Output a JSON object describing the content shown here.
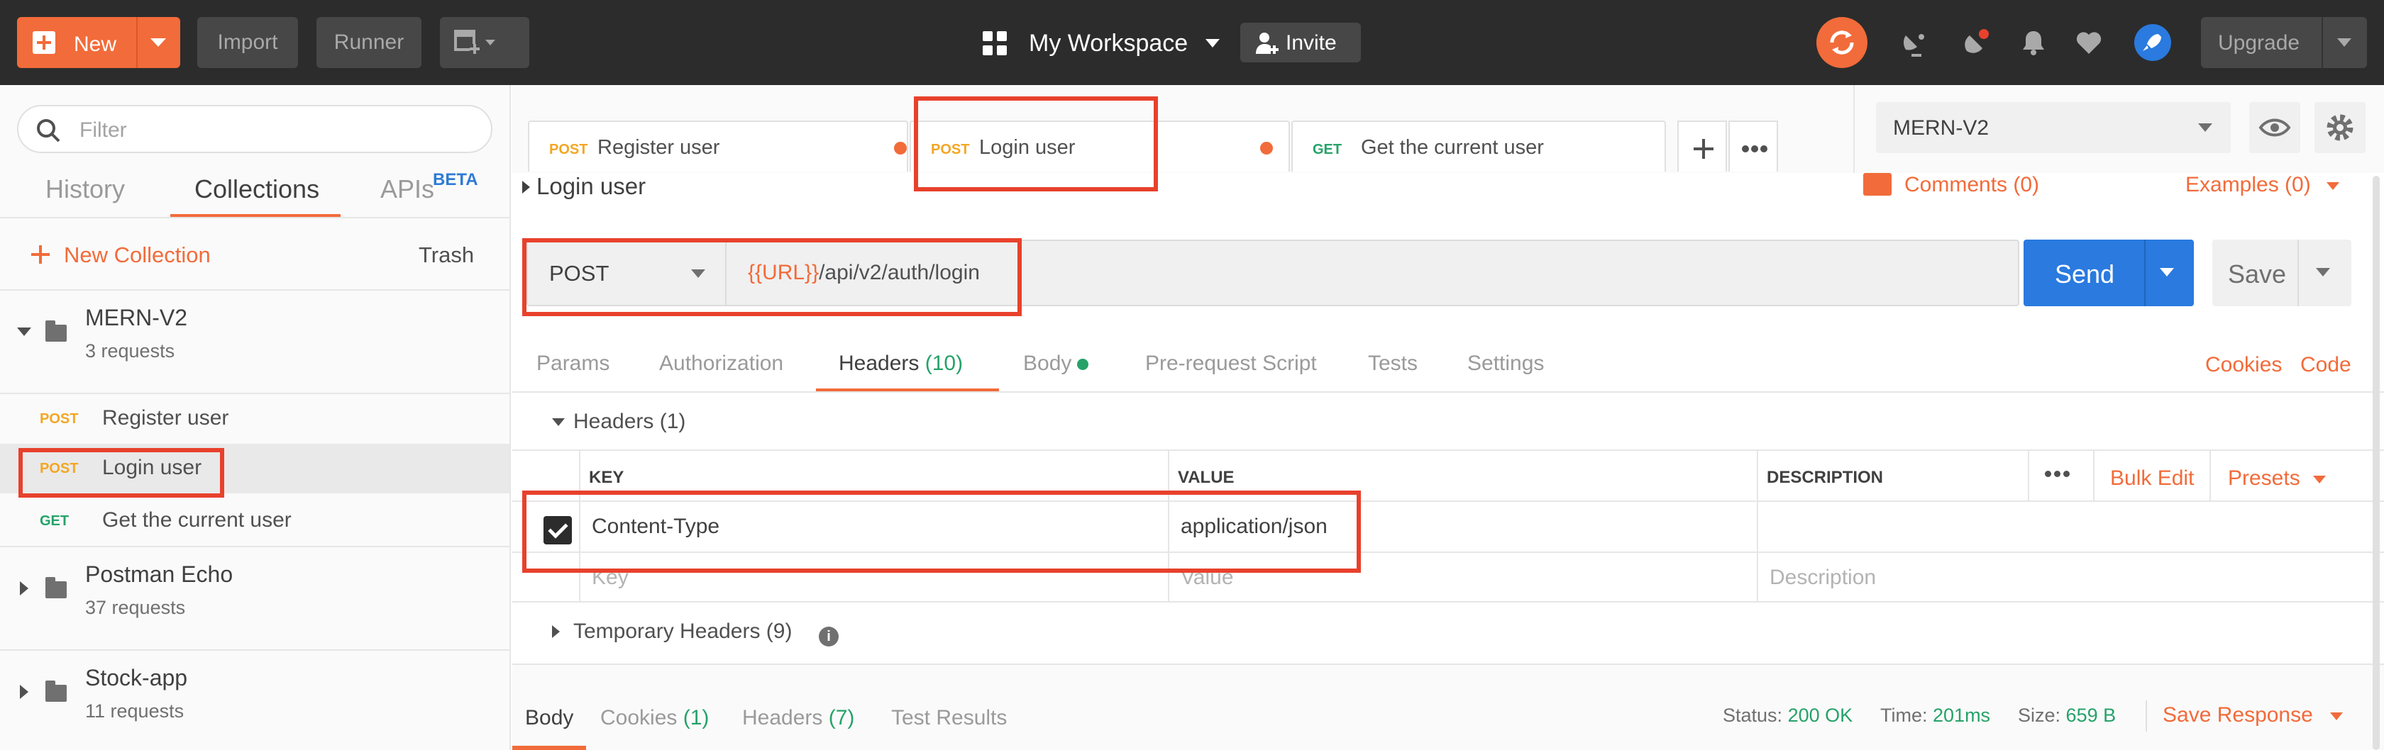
{
  "topbar": {
    "new_label": "New",
    "import_label": "Import",
    "runner_label": "Runner",
    "workspace_label": "My Workspace",
    "invite_label": "Invite",
    "upgrade_label": "Upgrade"
  },
  "sidebar": {
    "filter_placeholder": "Filter",
    "tabs": [
      "History",
      "Collections",
      "APIs"
    ],
    "active_tab": "Collections",
    "beta_badge": "BETA",
    "new_collection_label": "New Collection",
    "trash_label": "Trash",
    "collections": [
      {
        "name": "MERN-V2",
        "count": "3 requests",
        "expanded": true,
        "requests": [
          {
            "method": "POST",
            "name": "Register user",
            "selected": false
          },
          {
            "method": "POST",
            "name": "Login user",
            "selected": true
          },
          {
            "method": "GET",
            "name": "Get the current user",
            "selected": false
          }
        ]
      },
      {
        "name": "Postman Echo",
        "count": "37 requests",
        "expanded": false
      },
      {
        "name": "Stock-app",
        "count": "11 requests",
        "expanded": false
      }
    ]
  },
  "tabs": [
    {
      "method": "POST",
      "name": "Register user",
      "unsaved": true
    },
    {
      "method": "POST",
      "name": "Login user",
      "unsaved": true,
      "active": true
    },
    {
      "method": "GET",
      "name": "Get the current user",
      "unsaved": false
    }
  ],
  "environment": {
    "selected": "MERN-V2"
  },
  "request": {
    "name": "Login user",
    "comments_label": "Comments (0)",
    "examples_label": "Examples (0)",
    "method": "POST",
    "url_var": "{{URL}}",
    "url_path": "/api/v2/auth/login",
    "send_label": "Send",
    "save_label": "Save",
    "tabs": {
      "params": "Params",
      "authorization": "Authorization",
      "headers": "Headers",
      "headers_count": "(10)",
      "body": "Body",
      "prerequest": "Pre-request Script",
      "tests": "Tests",
      "settings": "Settings"
    },
    "cookies_link": "Cookies",
    "code_link": "Code",
    "headers_section": "Headers",
    "headers_section_count": "(1)",
    "columns": {
      "key": "KEY",
      "value": "VALUE",
      "description": "DESCRIPTION"
    },
    "bulk_edit_label": "Bulk Edit",
    "presets_label": "Presets",
    "header_rows": [
      {
        "enabled": true,
        "key": "Content-Type",
        "value": "application/json"
      }
    ],
    "placeholders": {
      "key": "Key",
      "value": "Value",
      "description": "Description"
    },
    "temporary_headers": "Temporary Headers",
    "temporary_headers_count": "(9)"
  },
  "response": {
    "tabs": {
      "body": "Body",
      "cookies": "Cookies",
      "cookies_count": "(1)",
      "headers": "Headers",
      "headers_count": "(7)",
      "tests": "Test Results"
    },
    "status_label": "Status:",
    "status_value": "200 OK",
    "time_label": "Time:",
    "time_value": "201ms",
    "size_label": "Size:",
    "size_value": "659 B",
    "save_response_label": "Save Response"
  },
  "colors": {
    "accent": "#f26b3a",
    "send_blue": "#2a7adf",
    "post": "#f4a623",
    "get": "#26a269",
    "annotation_red": "#e8412c"
  }
}
